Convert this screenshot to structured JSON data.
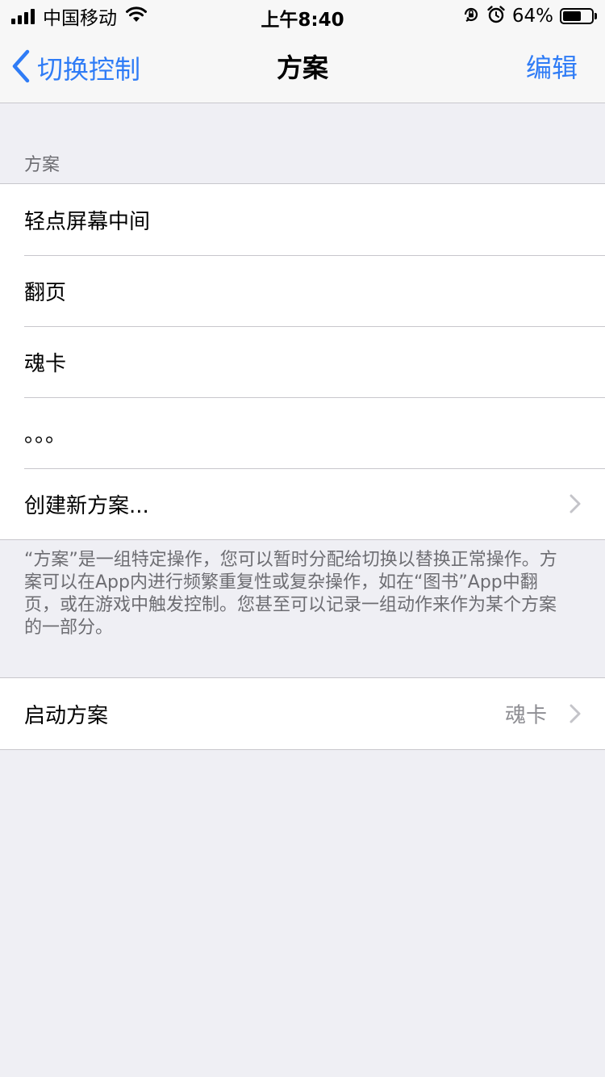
{
  "status_bar": {
    "carrier": "中国移动",
    "time": "上午8:40",
    "battery_percent_text": "64%",
    "battery_level": 0.64
  },
  "nav": {
    "back_label": "切换控制",
    "title": "方案",
    "edit_label": "编辑"
  },
  "recipes": {
    "header": "方案",
    "items": [
      {
        "label": "轻点屏幕中间"
      },
      {
        "label": "翻页"
      },
      {
        "label": "魂卡"
      },
      {
        "label": "。。。"
      }
    ],
    "create_label": "创建新方案...",
    "footer": "“方案”是一组特定操作，您可以暂时分配给切换以替换正常操作。方案可以在App内进行频繁重复性或复杂操作，如在“图书”App中翻页，或在游戏中触发控制。您甚至可以记录一组动作来作为某个方案的一部分。"
  },
  "launch": {
    "label": "启动方案",
    "value": "魂卡"
  },
  "colors": {
    "accent": "#2f7cf6",
    "background": "#efeff4",
    "separator": "#c8c7cc",
    "secondary_text": "#6d6d72"
  }
}
